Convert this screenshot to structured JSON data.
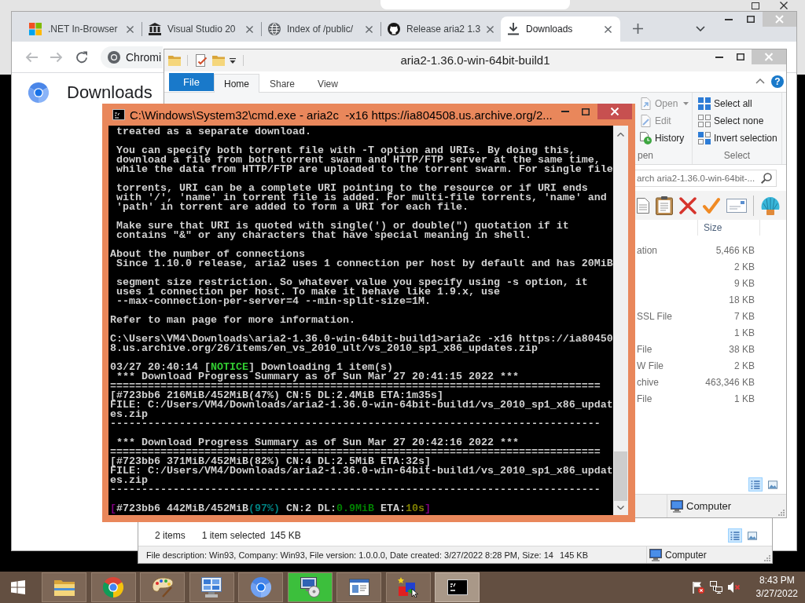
{
  "browser": {
    "tabs": [
      {
        "title": ".NET In-Browser",
        "selected": false
      },
      {
        "title": "Visual Studio 20",
        "selected": false
      },
      {
        "title": "Index of /public/",
        "selected": false
      },
      {
        "title": "Release aria2 1.3",
        "selected": false
      },
      {
        "title": "Downloads",
        "selected": true
      }
    ],
    "address": "Chromi",
    "page_title": "Downloads"
  },
  "explorer": {
    "title": "aria2-1.36.0-win-64bit-build1",
    "file_tab": "File",
    "ribbon_tabs": [
      {
        "label": "Home",
        "selected": true
      },
      {
        "label": "Share",
        "selected": false
      },
      {
        "label": "View",
        "selected": false
      }
    ],
    "help": "?",
    "open_group": {
      "label": "pen",
      "commands": [
        {
          "label": "Open",
          "disabled": true,
          "dropdown": true
        },
        {
          "label": "Edit",
          "disabled": true,
          "dropdown": false
        },
        {
          "label": "History",
          "disabled": false,
          "dropdown": false
        }
      ]
    },
    "select_group": {
      "label": "Select",
      "commands": [
        {
          "label": "Select all"
        },
        {
          "label": "Select none"
        },
        {
          "label": "Invert selection"
        }
      ]
    },
    "search": {
      "placeholder": "arch aria2-1.36.0-win-64bit-..."
    },
    "size_column": "Size",
    "rows": [
      {
        "column_1": "ation",
        "size": "5,466 KB"
      },
      {
        "size": "2 KB"
      },
      {
        "size": "9 KB"
      },
      {
        "size": "18 KB"
      },
      {
        "column_1": "SSL File",
        "size": "7 KB"
      },
      {
        "size": "1 KB"
      },
      {
        "column_1": "File",
        "size": "38 KB"
      },
      {
        "column_1": "W File",
        "size": "2 KB"
      },
      {
        "column_1": "chive",
        "size": "463,346 KB"
      },
      {
        "column_1": "File",
        "size": "1 KB"
      }
    ],
    "view_buttons": [
      {
        "selected": true
      },
      {
        "selected": false
      }
    ],
    "location": "Computer"
  },
  "back_explorer": {
    "item_count": "2 items",
    "selection": "1 item selected",
    "selection_size": "145 KB",
    "view_buttons": [
      {
        "selected": true
      },
      {
        "selected": false
      }
    ],
    "details": "File description: Win93, Company: Win93, File version: 1.0.0.0, Date created: 3/27/2022 8:28 PM, Size: 14",
    "details_size": "145 KB",
    "location": "Computer"
  },
  "cmd": {
    "title": "C:\\Windows\\System32\\cmd.exe - aria2c  -x16 https://ia804508.us.archive.org/2...",
    "blocks": [
      [
        " treated as a separate download."
      ],
      [
        " You can specify both torrent file with -T option and URIs. By doing this,",
        " download a file from both torrent swarm and HTTP/FTP server at the same time,",
        " while the data from HTTP/FTP are uploaded to the torrent swarm. For single file"
      ],
      [
        " torrents, URI can be a complete URI pointing to the resource or if URI ends",
        " with '/', 'name' in torrent file is added. For multi-file torrents, 'name' and",
        " 'path' in torrent are added to form a URI for each file."
      ],
      [
        " Make sure that URI is quoted with single(') or double(\") quotation if it",
        " contains \"&\" or any characters that have special meaning in shell."
      ],
      [
        "About the number of connections",
        " Since 1.10.0 release, aria2 uses 1 connection per host by default and has 20MiB"
      ],
      [
        " segment size restriction. So whatever value you specify using -s option, it",
        " uses 1 connection per host. To make it behave like 1.9.x, use",
        " --max-connection-per-server=4 --min-split-size=1M."
      ],
      [
        "Refer to man page for more information."
      ],
      [
        "C:\\Users\\VM4\\Downloads\\aria2-1.36.0-win-64bit-build1>aria2c -x16 https://ia80450",
        "8.us.archive.org/26/items/en_vs_2010_ult/vs_2010_sp1_x86_updates.zip"
      ],
      [
        {
          "segments": [
            {
              "text": "03/27 20:40:14 ["
            },
            {
              "text": "NOTICE",
              "color": "#32cd32"
            },
            {
              "text": "] Downloading 1 item(s)"
            }
          ]
        },
        " *** Download Progress Summary as of Sun Mar 27 20:41:15 2022 ***",
        "==============================================================================",
        "[#723bb6 216MiB/452MiB(47%) CN:5 DL:2.4MiB ETA:1m35s]",
        "FILE: C:/Users/VM4/Downloads/aria2-1.36.0-win-64bit-build1/vs_2010_sp1_x86_updat",
        "es.zip",
        "------------------------------------------------------------------------------"
      ],
      [
        " *** Download Progress Summary as of Sun Mar 27 20:42:16 2022 ***",
        "==============================================================================",
        "[#723bb6 371MiB/452MiB(82%) CN:4 DL:2.5MiB ETA:32s]",
        "FILE: C:/Users/VM4/Downloads/aria2-1.36.0-win-64bit-build1/vs_2010_sp1_x86_updat",
        "es.zip",
        "------------------------------------------------------------------------------"
      ],
      [
        {
          "segments": [
            {
              "text": "[",
              "color": "#800080"
            },
            {
              "text": "#723bb6 442MiB/452MiB"
            },
            {
              "text": "(97%)",
              "color": "#008080"
            },
            {
              "text": " CN:2 DL:"
            },
            {
              "text": "0.9MiB",
              "color": "#008000"
            },
            {
              "text": " ETA:"
            },
            {
              "text": "10s",
              "color": "#808000"
            },
            {
              "text": "]",
              "color": "#800080"
            }
          ]
        }
      ]
    ]
  },
  "taskbar": {
    "apps": [
      {
        "selected": false
      },
      {
        "selected": false
      },
      {
        "selected": false
      },
      {
        "selected": false
      },
      {
        "selected": false
      },
      {
        "selected": false,
        "level": 1
      },
      {
        "selected": false
      },
      {
        "selected": false
      },
      {
        "selected": true
      }
    ],
    "time": "8:43 PM",
    "date": "3/27/2022"
  }
}
